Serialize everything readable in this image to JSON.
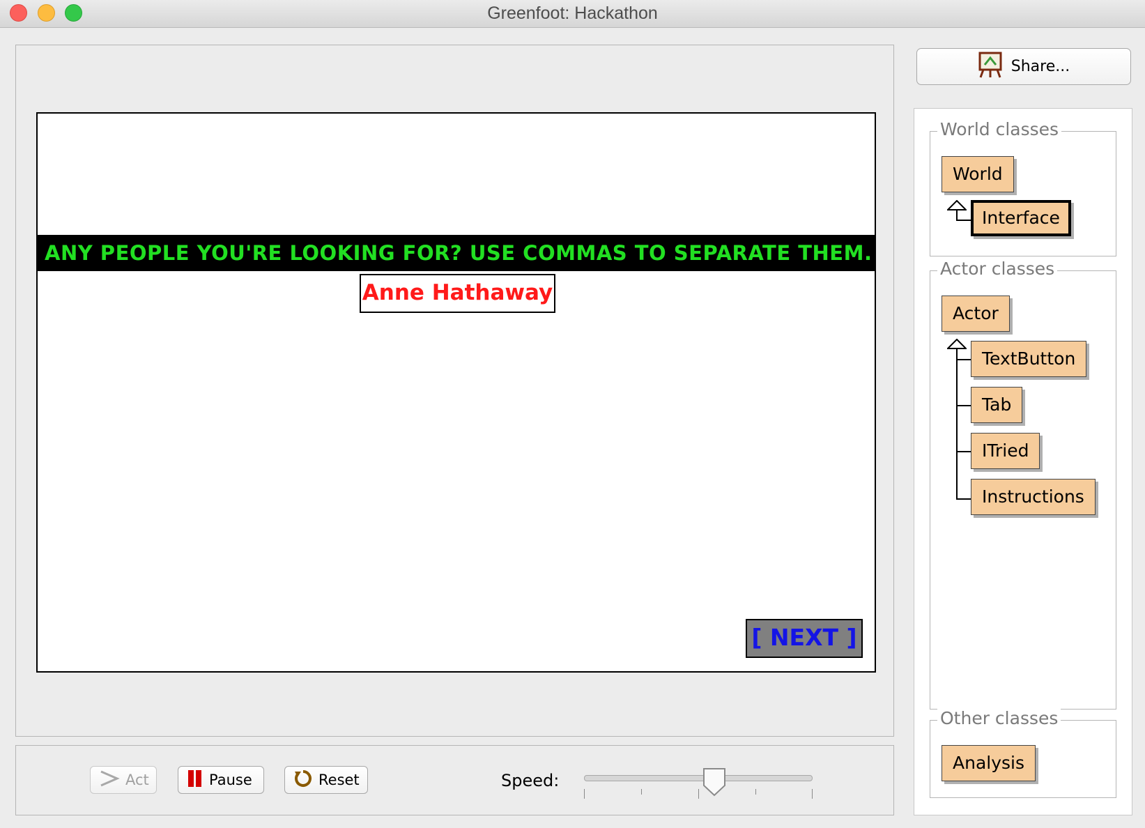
{
  "window": {
    "title": "Greenfoot: Hackathon"
  },
  "world": {
    "banner_text": "ANY PEOPLE YOU'RE LOOKING FOR? USE COMMAS TO SEPARATE THEM.",
    "input_value": "Anne Hathaway",
    "next_label": "[ NEXT ]",
    "colors": {
      "banner_text": "#22e022",
      "input_text": "#ff1a1a",
      "next_text": "#1414e6",
      "next_bg": "#808080"
    }
  },
  "controls": {
    "act_label": "Act",
    "pause_label": "Pause",
    "reset_label": "Reset",
    "speed_label": "Speed:",
    "speed_value": 0.57
  },
  "share": {
    "label": "Share..."
  },
  "classes": {
    "world_group": {
      "title": "World classes",
      "items": [
        "World",
        "Interface"
      ],
      "selected": "Interface"
    },
    "actor_group": {
      "title": "Actor classes",
      "items": [
        "Actor",
        "TextButton",
        "Tab",
        "ITried",
        "Instructions"
      ]
    },
    "other_group": {
      "title": "Other classes",
      "items": [
        "Analysis"
      ]
    }
  }
}
